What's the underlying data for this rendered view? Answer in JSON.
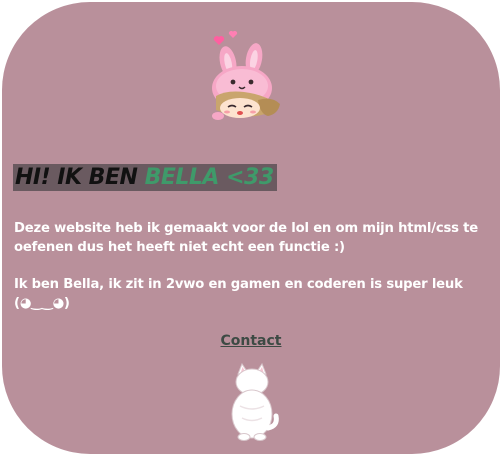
{
  "heading": {
    "prefix": "HI! IK BEN",
    "name": "BELLA <33"
  },
  "paragraphs": [
    "Deze website heb ik gemaakt voor de lol en om mijn html/css te oefenen dus het heeft niet echt een functie :)",
    "Ik ben Bella, ik zit in 2vwo en gamen en coderen is super leuk (◕‿‿◕)"
  ],
  "contact_link": "Contact",
  "colors": {
    "card_background": "#b9909b",
    "heading_highlight": "#6a5a60",
    "heading_name": "#3f9a6a",
    "link": "#3d4a44"
  },
  "images": {
    "avatar": "bunny-hood-girl-pixel-art",
    "cat": "white-cat-pixel-art"
  }
}
